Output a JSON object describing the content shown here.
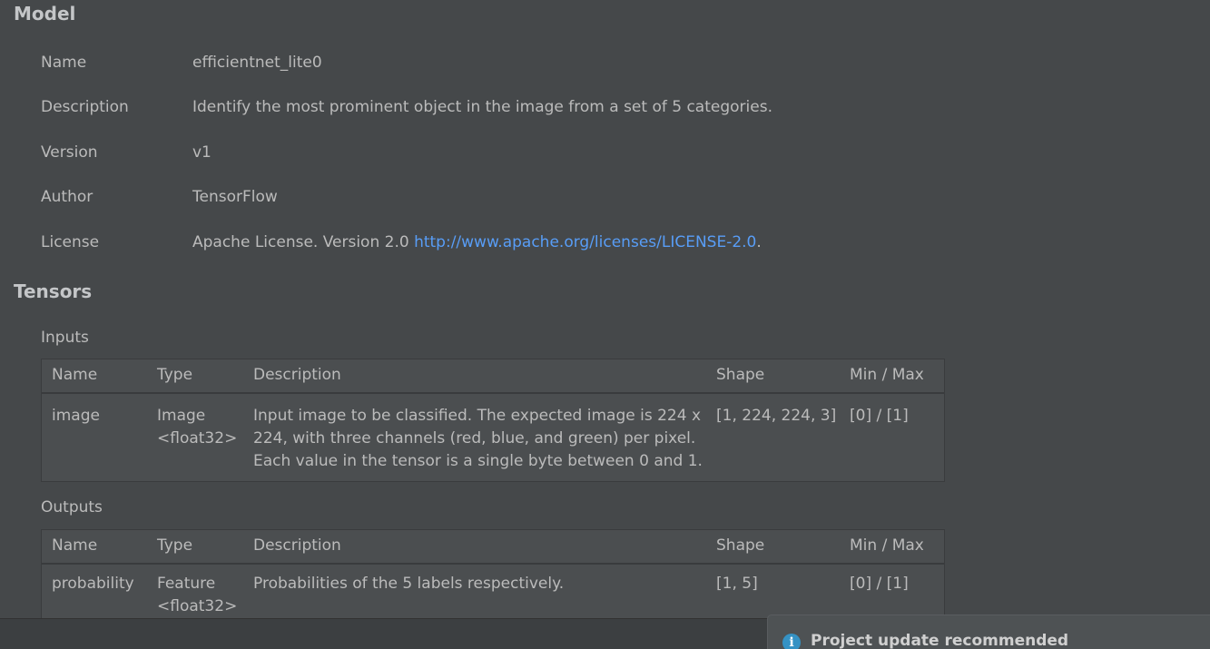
{
  "model": {
    "title": "Model",
    "fields": [
      {
        "key": "Name",
        "value": "efficientnet_lite0"
      },
      {
        "key": "Description",
        "value": "Identify the most prominent object in the image from a set of 5 categories."
      },
      {
        "key": "Version",
        "value": "v1"
      },
      {
        "key": "Author",
        "value": "TensorFlow"
      }
    ],
    "license": {
      "key": "License",
      "prefix": "Apache License. Version 2.0 ",
      "link": "http://www.apache.org/licenses/LICENSE-2.0",
      "suffix": "."
    }
  },
  "tensors": {
    "title": "Tensors",
    "columns": {
      "name": "Name",
      "type": "Type",
      "description": "Description",
      "shape": "Shape",
      "minmax": "Min / Max"
    },
    "inputs": {
      "title": "Inputs",
      "rows": [
        {
          "name": "image",
          "type_line1": "Image",
          "type_line2": "<float32>",
          "desc_line1": "Input image to be classified. The expected image is 224 x",
          "desc_line2": "224, with three channels (red, blue, and green) per pixel.",
          "desc_line3": "Each value in the tensor is a single byte between 0 and 1.",
          "shape": "[1, 224, 224, 3]",
          "minmax": "[0] / [1]"
        }
      ]
    },
    "outputs": {
      "title": "Outputs",
      "rows": [
        {
          "name": "probability",
          "type_line1": "Feature",
          "type_line2": "<float32>",
          "desc_line1": "Probabilities of the 5 labels respectively.",
          "shape": "[1, 5]",
          "minmax": "[0] / [1]"
        }
      ]
    }
  },
  "notification": {
    "icon": "info-icon",
    "icon_glyph": "i",
    "title": "Project update recommended"
  }
}
